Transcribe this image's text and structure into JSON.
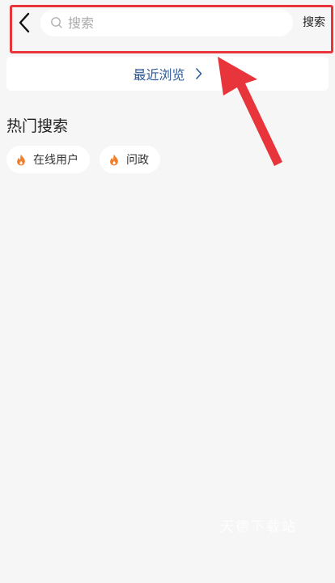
{
  "header": {
    "back_icon": "chevron-left-icon",
    "search_icon": "search-icon",
    "search_placeholder": "搜索",
    "search_value": "",
    "search_button_label": "搜索"
  },
  "recent": {
    "label": "最近浏览",
    "icon": "chevron-right-icon"
  },
  "hot_search": {
    "title": "热门搜索",
    "items": [
      {
        "label": "在线用户",
        "icon": "flame-icon"
      },
      {
        "label": "问政",
        "icon": "flame-icon"
      }
    ]
  },
  "watermark": "天德下载站",
  "colors": {
    "background": "#f6f6f6",
    "link": "#2c5a9a",
    "flame": "#f07e2a",
    "annotation": "#e8343b"
  }
}
